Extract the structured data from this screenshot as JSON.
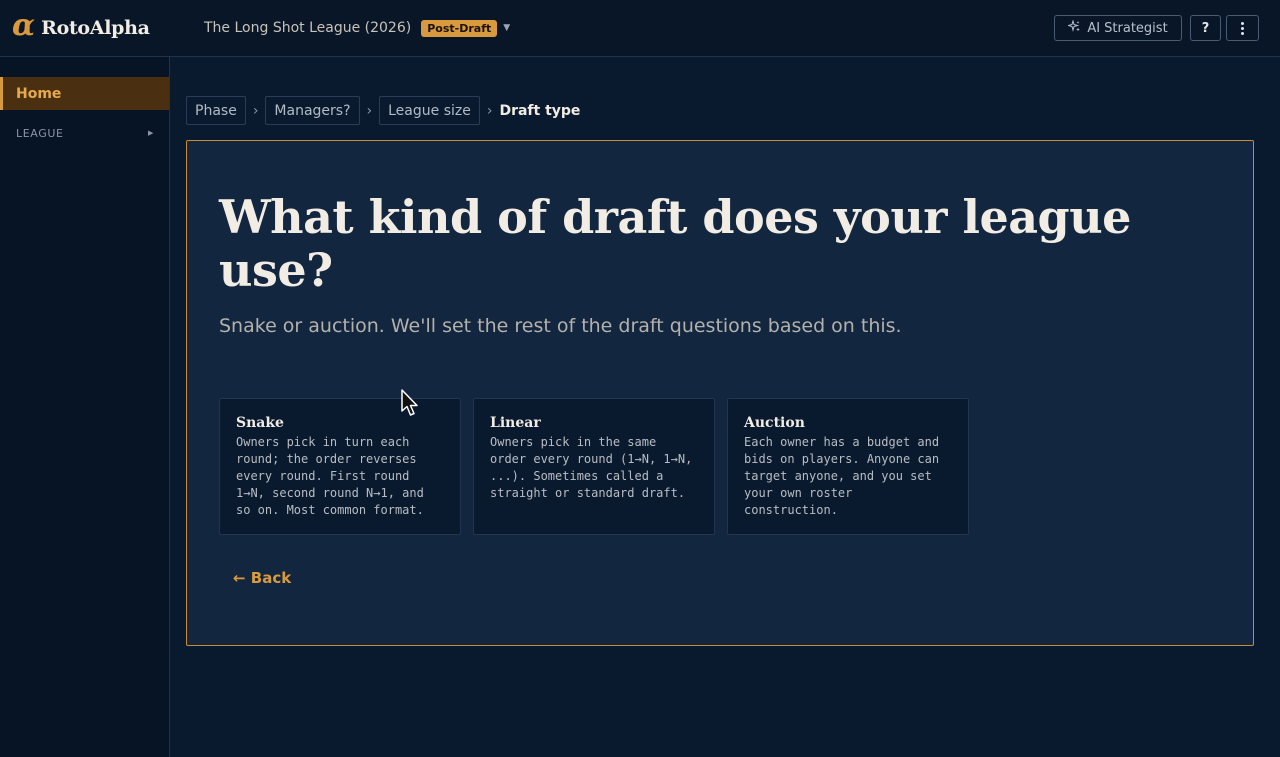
{
  "app": {
    "logo_mark": "α",
    "name": "RotoAlpha"
  },
  "header": {
    "league_name": "The Long Shot League (2026)",
    "phase_badge": "Post-Draft",
    "ai_button_label": "AI Strategist",
    "help_label": "?"
  },
  "sidebar": {
    "home_label": "Home",
    "league_section_label": "LEAGUE"
  },
  "breadcrumb": {
    "items": [
      "Phase",
      "Managers?",
      "League size"
    ],
    "current": "Draft type"
  },
  "question": {
    "headline": "What kind of draft does your league use?",
    "subtitle": "Snake or auction. We'll set the rest of the draft questions based on this.",
    "options": [
      {
        "title": "Snake",
        "description": "Owners pick in turn each round; the order reverses every round. First round 1→N, second round N→1, and so on. Most common format."
      },
      {
        "title": "Linear",
        "description": "Owners pick in the same order every round (1→N, 1→N, ...). Sometimes called a straight or standard draft."
      },
      {
        "title": "Auction",
        "description": "Each owner has a budget and bids on players. Anyone can target anyone, and you set your own roster construction."
      }
    ],
    "back_label": "← Back"
  },
  "colors": {
    "accent": "#d99a3e",
    "background": "#0a1a2e",
    "panel": "#13263f"
  }
}
